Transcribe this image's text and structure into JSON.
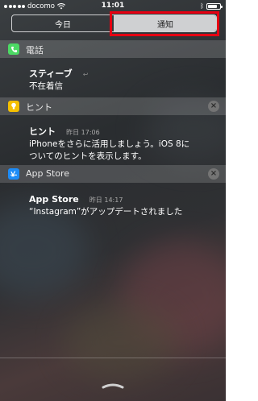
{
  "status_bar": {
    "carrier": "docomo",
    "time": "11:01",
    "battery_level": 0.7
  },
  "segmented_control": {
    "tabs": [
      {
        "label": "今日",
        "selected": false
      },
      {
        "label": "通知",
        "selected": true
      }
    ]
  },
  "sections": [
    {
      "app": "電話",
      "icon": "phone-icon",
      "notifications": [
        {
          "title": "スティーブ",
          "time": "",
          "body": "不在着信",
          "reply_icon": "reply-icon"
        }
      ]
    },
    {
      "app": "ヒント",
      "icon": "lightbulb-icon",
      "notifications": [
        {
          "title": "ヒント",
          "time": "昨日 17:06",
          "body_line1": "iPhoneをさらに活用しましょう。iOS 8に",
          "body_line2": "ついてのヒントを表示します。"
        }
      ]
    },
    {
      "app": "App Store",
      "icon": "app-store-icon",
      "notifications": [
        {
          "title": "App Store",
          "time": "昨日 14:17",
          "body": "“Instagram”がアップデートされました"
        }
      ]
    }
  ],
  "colors": {
    "highlight": "#e60012",
    "phone_icon": "#4cd964",
    "tips_icon": "#f5c000",
    "app_store_icon": "#1d8cf7"
  }
}
